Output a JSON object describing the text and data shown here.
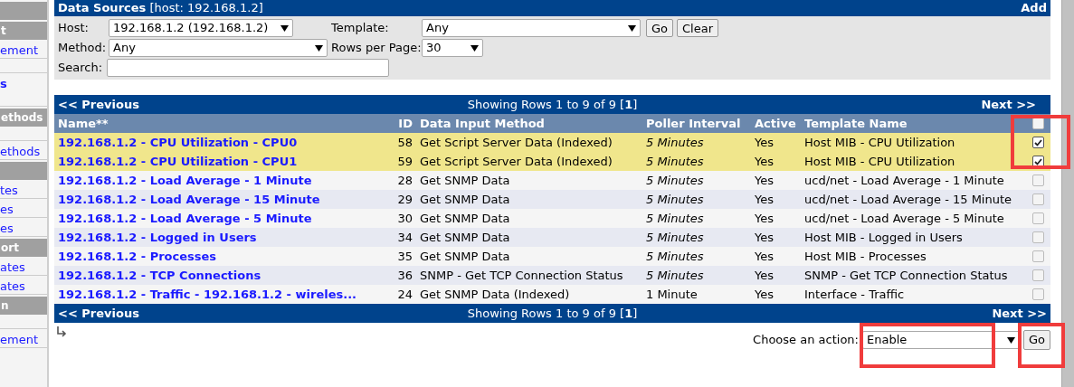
{
  "sidebar": {
    "items": [
      {
        "kind": "header"
      },
      {
        "kind": "header",
        "label": "t"
      },
      {
        "kind": "link",
        "label": "ement"
      },
      {
        "kind": "blank"
      },
      {
        "kind": "bold_link",
        "label": "s"
      },
      {
        "kind": "blank"
      },
      {
        "kind": "header",
        "label": "ethods"
      },
      {
        "kind": "blank"
      },
      {
        "kind": "link",
        "label": "ethods"
      },
      {
        "kind": "header"
      },
      {
        "kind": "link",
        "label": "tes"
      },
      {
        "kind": "link",
        "label": "es"
      },
      {
        "kind": "link",
        "label": "es"
      },
      {
        "kind": "header",
        "label": "ort"
      },
      {
        "kind": "link",
        "label": "ates"
      },
      {
        "kind": "link",
        "label": "ates"
      },
      {
        "kind": "header",
        "label": "n"
      },
      {
        "kind": "blank"
      },
      {
        "kind": "link",
        "label": "ement"
      }
    ]
  },
  "panel": {
    "title": "Data Sources",
    "subtitle": "[host: 192.168.1.2]",
    "add": "Add"
  },
  "filters": {
    "host": {
      "label": "Host:",
      "value": "192.168.1.2 (192.168.1.2)"
    },
    "template": {
      "label": "Template:",
      "value": "Any"
    },
    "go": "Go",
    "clear": "Clear",
    "method": {
      "label": "Method:",
      "value": "Any"
    },
    "rows": {
      "label": "Rows per Page:",
      "value": "30"
    },
    "search": {
      "label": "Search:"
    }
  },
  "top_nav": {
    "previous": "<< Previous",
    "showing": "Showing Rows 1 to 9 of 9 [**1**]",
    "next": "Next >>"
  },
  "table": {
    "columns": [
      "Name**",
      "ID",
      "Data Input Method",
      "Poller Interval",
      "Active",
      "Template Name"
    ],
    "all_checked": false,
    "rows": [
      {
        "name": "192.168.1.2 - CPU Utilization - CPU0",
        "id": "58",
        "method": "Get Script Server Data (Indexed)",
        "interval": "5 Minutes",
        "interval_italic": true,
        "active": "Yes",
        "template": "Host MIB - CPU Utilization",
        "checked": true
      },
      {
        "name": "192.168.1.2 - CPU Utilization - CPU1",
        "id": "59",
        "method": "Get Script Server Data (Indexed)",
        "interval": "5 Minutes",
        "interval_italic": true,
        "active": "Yes",
        "template": "Host MIB - CPU Utilization",
        "checked": true
      },
      {
        "name": "192.168.1.2 - Load Average - 1 Minute",
        "id": "28",
        "method": "Get SNMP Data",
        "interval": "5 Minutes",
        "interval_italic": true,
        "active": "Yes",
        "template": "ucd/net - Load Average - 1 Minute",
        "checked": false
      },
      {
        "name": "192.168.1.2 - Load Average - 15 Minute",
        "id": "29",
        "method": "Get SNMP Data",
        "interval": "5 Minutes",
        "interval_italic": true,
        "active": "Yes",
        "template": "ucd/net - Load Average - 15 Minute",
        "checked": false
      },
      {
        "name": "192.168.1.2 - Load Average - 5 Minute",
        "id": "30",
        "method": "Get SNMP Data",
        "interval": "5 Minutes",
        "interval_italic": true,
        "active": "Yes",
        "template": "ucd/net - Load Average - 5 Minute",
        "checked": false
      },
      {
        "name": "192.168.1.2 - Logged in Users",
        "id": "34",
        "method": "Get SNMP Data",
        "interval": "5 Minutes",
        "interval_italic": true,
        "active": "Yes",
        "template": "Host MIB - Logged in Users",
        "checked": false
      },
      {
        "name": "192.168.1.2 - Processes",
        "id": "35",
        "method": "Get SNMP Data",
        "interval": "5 Minutes",
        "interval_italic": true,
        "active": "Yes",
        "template": "Host MIB - Processes",
        "checked": false
      },
      {
        "name": "192.168.1.2 - TCP Connections",
        "id": "36",
        "method": "SNMP - Get TCP Connection Status",
        "interval": "5 Minutes",
        "interval_italic": true,
        "active": "Yes",
        "template": "SNMP - Get TCP Connection Status",
        "checked": false
      },
      {
        "name": "192.168.1.2 - Traffic - 192.168.1.2 - wireles...",
        "id": "24",
        "method": "Get SNMP Data (Indexed)",
        "interval": "1 Minute",
        "interval_italic": false,
        "active": "Yes",
        "template": "Interface - Traffic",
        "checked": false
      }
    ]
  },
  "bottom_nav": {
    "previous": "<< Previous",
    "showing": "Showing Rows 1 to 9 of 9 [**1**]",
    "next": "Next >>"
  },
  "action": {
    "label": "Choose an action:",
    "value": "Enable",
    "go": "Go"
  }
}
